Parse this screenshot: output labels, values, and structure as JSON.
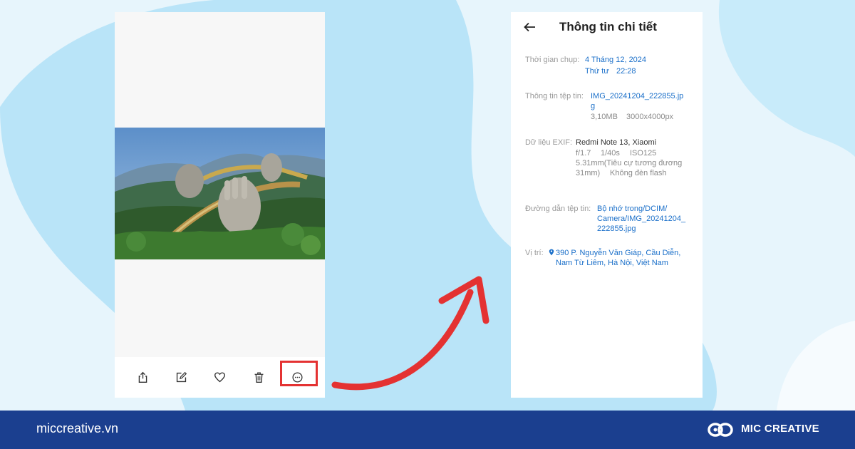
{
  "details": {
    "title": "Thông tin chi tiết",
    "capture_time": {
      "label": "Thời gian chụp:",
      "date": "4 Tháng 12, 2024",
      "weekday": "Thứ tư",
      "time": "22:28"
    },
    "file_info": {
      "label": "Thông tin tệp tin:",
      "name_line1": "IMG_20241204_222855.jp",
      "name_line2": "g",
      "size": "3,10MB",
      "resolution": "3000x4000px"
    },
    "exif": {
      "label": "Dữ liệu EXIF:",
      "device": "Redmi Note 13, Xiaomi",
      "aperture": "f/1.7",
      "shutter": "1/40s",
      "iso": "ISO125",
      "focal_line1": "5.31mm(Tiêu cự tương đương",
      "focal_line2": "31mm)",
      "flash": "Không đèn flash"
    },
    "path": {
      "label": "Đường dẫn tệp tin:",
      "line1": "Bộ nhớ trong/DCIM/",
      "line2": "Camera/IMG_20241204_",
      "line3": "222855.jpg"
    },
    "location": {
      "label": "Vị trí:",
      "line1": "390 P. Nguyễn Văn Giáp, Cầu Diễn,",
      "line2": "Nam Từ Liêm, Hà Nội, Việt Nam"
    }
  },
  "toolbar": {
    "icons": [
      "share-icon",
      "edit-icon",
      "heart-icon",
      "trash-icon",
      "more-icon"
    ]
  },
  "footer": {
    "url": "miccreative.vn",
    "brand": "MIC CREATIVE"
  },
  "colors": {
    "accent_blue": "#1a6fc9",
    "highlight_red": "#e43232",
    "footer_bg": "#1b3f8f",
    "background_light": "#e7f5fc",
    "background_blob": "#b9e4f8"
  }
}
